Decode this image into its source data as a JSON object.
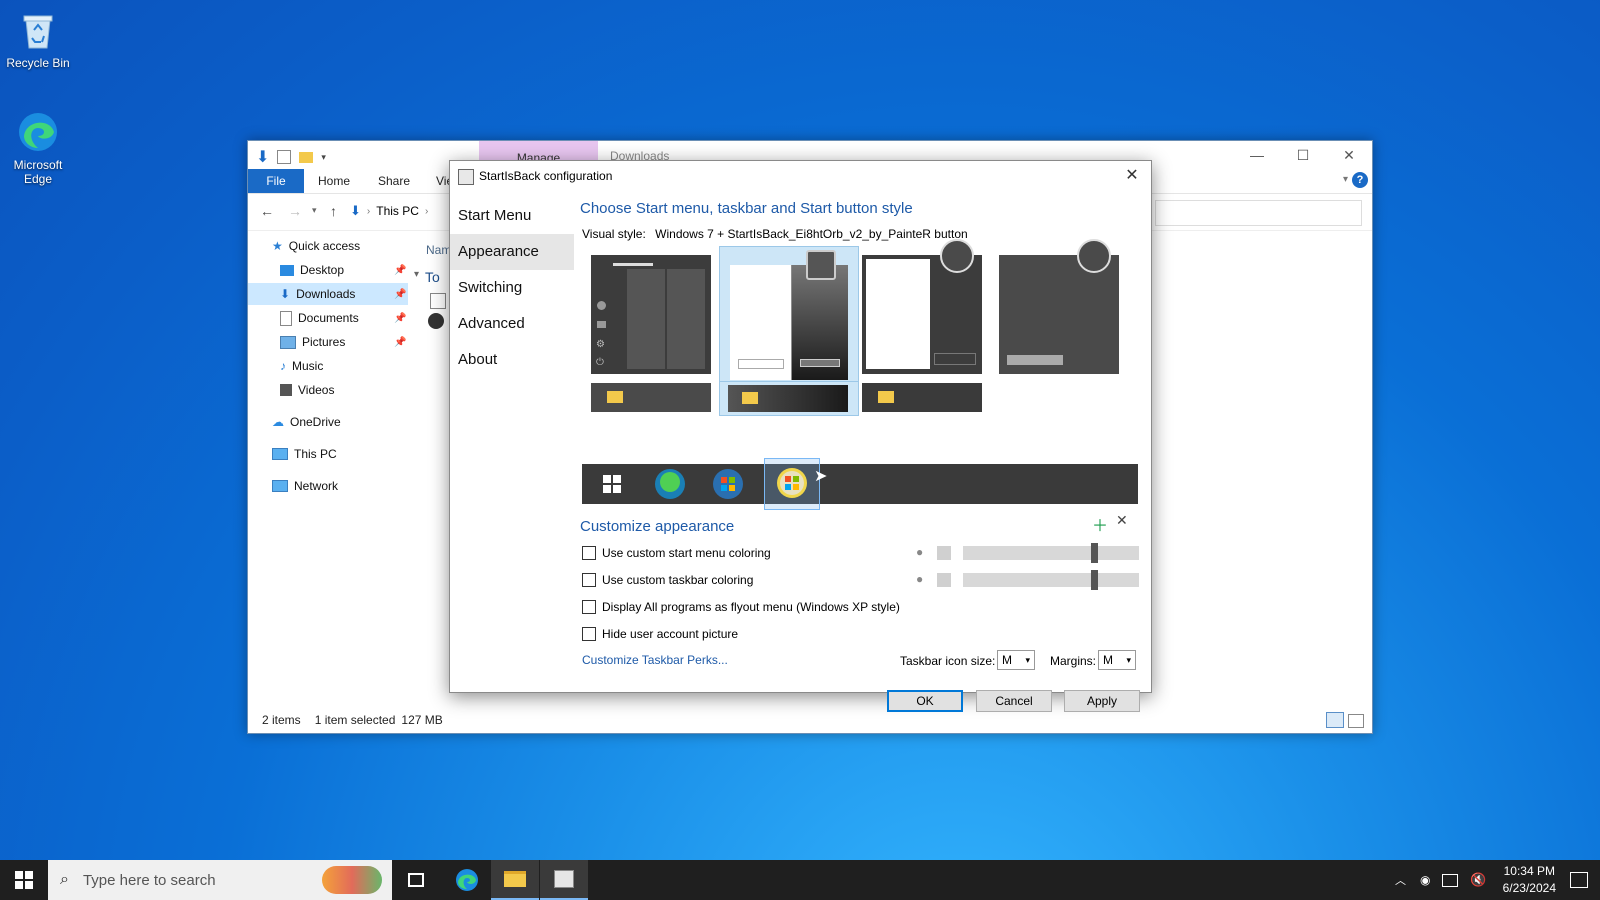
{
  "desktop": {
    "icons": [
      {
        "label": "Recycle Bin"
      },
      {
        "label": "Microsoft Edge"
      }
    ]
  },
  "explorer": {
    "manage_tab": "Manage",
    "title": "Downloads",
    "ribbon_tabs": [
      "File",
      "Home",
      "Share",
      "Vie"
    ],
    "breadcrumb": "This PC",
    "column_header": "Nam",
    "group_header": "To",
    "nav": {
      "quick_access": "Quick access",
      "desktop": "Desktop",
      "downloads": "Downloads",
      "documents": "Documents",
      "pictures": "Pictures",
      "music": "Music",
      "videos": "Videos",
      "onedrive": "OneDrive",
      "this_pc": "This PC",
      "network": "Network"
    },
    "status": {
      "items": "2 items",
      "selected": "1 item selected",
      "size": "127 MB"
    }
  },
  "dialog": {
    "title": "StartIsBack configuration",
    "nav": [
      "Start Menu",
      "Appearance",
      "Switching",
      "Advanced",
      "About"
    ],
    "selected_nav": "Appearance",
    "heading": "Choose Start menu, taskbar and Start button style",
    "visual_style_label": "Visual style:",
    "visual_style_value": "Windows 7 + StartIsBack_Ei8htOrb_v2_by_PainteR button",
    "customize_heading": "Customize appearance",
    "options": [
      {
        "label": "Use custom start menu coloring",
        "checked": false,
        "level": 0.76
      },
      {
        "label": "Use custom taskbar coloring",
        "checked": false,
        "level": 0.76
      },
      {
        "label": "Display All programs as flyout menu (Windows XP style)",
        "checked": false
      },
      {
        "label": "Hide user account picture",
        "checked": false
      }
    ],
    "perks_link": "Customize Taskbar Perks...",
    "icon_size_label": "Taskbar icon size:",
    "icon_size_value": "M",
    "margins_label": "Margins:",
    "margins_value": "M",
    "buttons": {
      "ok": "OK",
      "cancel": "Cancel",
      "apply": "Apply"
    }
  },
  "taskbar": {
    "search_placeholder": "Type here to search",
    "time": "10:34 PM",
    "date": "6/23/2024"
  },
  "colors": {
    "accent": "#0078d7",
    "link": "#1e5aa8",
    "taskbar": "#1f1f1f"
  }
}
